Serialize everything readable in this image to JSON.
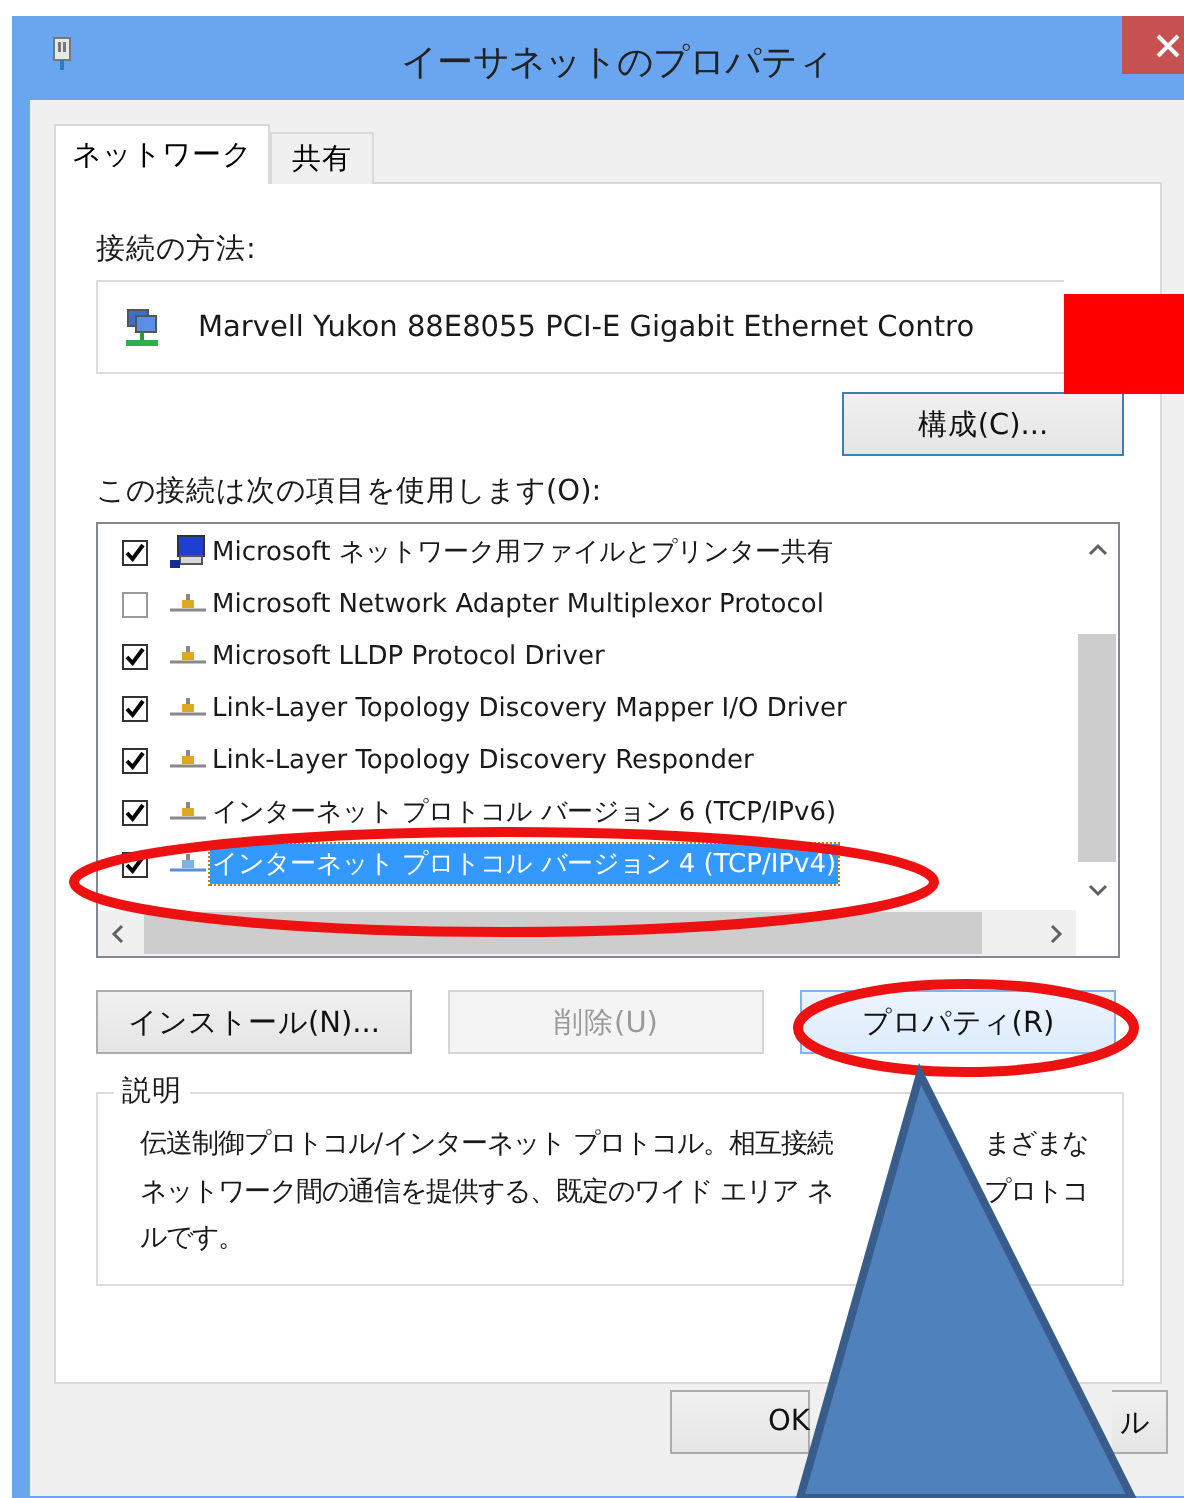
{
  "window": {
    "title": "イーサネットのプロパティ"
  },
  "tabs": [
    {
      "label": "ネットワーク",
      "selected": true
    },
    {
      "label": "共有",
      "selected": false
    }
  ],
  "connect_using": {
    "label": "接続の方法:",
    "adapter": "Marvell Yukon 88E8055 PCI-E Gigabit Ethernet Contro"
  },
  "configure_button": {
    "label": "構成(C)..."
  },
  "items_label": "この接続は次の項目を使用します(O):",
  "items": [
    {
      "kind": "client",
      "label": "Microsoft ネットワーク用ファイルとプリンター共有",
      "checked": true,
      "selected": false
    },
    {
      "kind": "protocol",
      "label": "Microsoft Network Adapter Multiplexor Protocol",
      "checked": false,
      "selected": false
    },
    {
      "kind": "protocol",
      "label": "Microsoft LLDP Protocol Driver",
      "checked": true,
      "selected": false
    },
    {
      "kind": "protocol",
      "label": "Link-Layer Topology Discovery Mapper I/O Driver",
      "checked": true,
      "selected": false
    },
    {
      "kind": "protocol",
      "label": "Link-Layer Topology Discovery Responder",
      "checked": true,
      "selected": false
    },
    {
      "kind": "protocol",
      "label": "インターネット プロトコル バージョン 6 (TCP/IPv6)",
      "checked": true,
      "selected": false
    },
    {
      "kind": "protocol",
      "label": "インターネット プロトコル バージョン 4 (TCP/IPv4)",
      "checked": true,
      "selected": true
    }
  ],
  "buttons": [
    {
      "label": "インストール(N)...",
      "disabled": false,
      "focused": false
    },
    {
      "label": "削除(U)",
      "disabled": true,
      "focused": false
    },
    {
      "label": "プロパティ(R)",
      "disabled": false,
      "focused": true
    }
  ],
  "description": {
    "title": "説明",
    "lines": [
      [
        "伝送制御プロトコル/インターネット プロトコル。相互接続",
        "まざまな"
      ],
      [
        "ネットワーク間の通信を提供する、既定のワイド エリア ネ",
        "プロトコ"
      ],
      [
        "ルです。"
      ]
    ]
  },
  "footer_buttons": [
    {
      "label": "OK"
    },
    {
      "label": "ル"
    }
  ]
}
